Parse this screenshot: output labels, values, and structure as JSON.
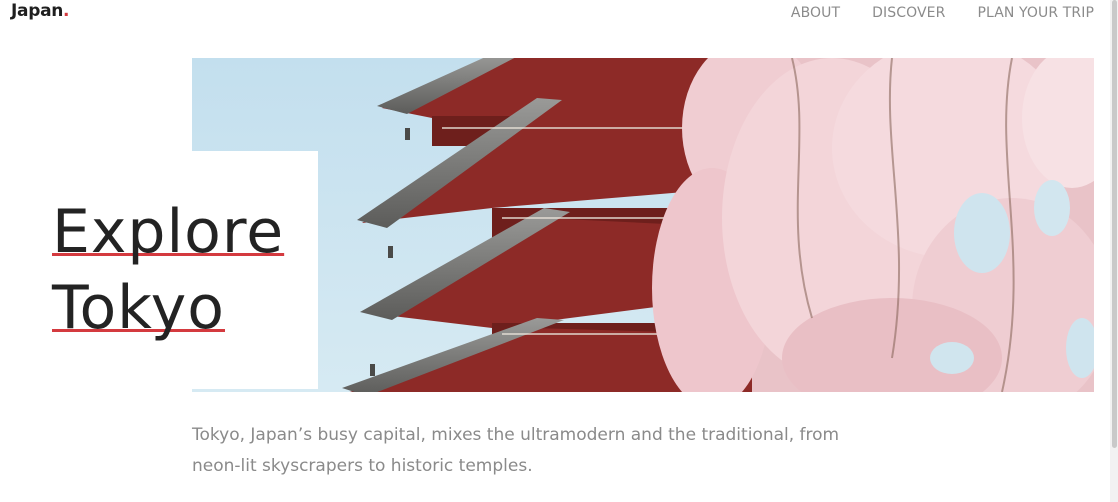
{
  "header": {
    "brand": "Japan",
    "brand_dot": ".",
    "nav": [
      {
        "label": "ABOUT"
      },
      {
        "label": "DISCOVER"
      },
      {
        "label": "PLAN YOUR TRIP"
      }
    ]
  },
  "hero": {
    "title_line1": "Explore",
    "title_line2": "Tokyo",
    "image": "pagoda-with-cherry-blossoms"
  },
  "description": "Tokyo, Japan’s busy capital, mixes the ultramodern and the traditional, from neon-lit skyscrapers to historic temples.",
  "colors": {
    "accent": "#d43a3f",
    "text_dark": "#232323",
    "text_muted": "#8a8a8a",
    "pagoda_red": "#8a2a26",
    "blossom": "#f1cfd4",
    "sky": "#c9e2ef"
  }
}
